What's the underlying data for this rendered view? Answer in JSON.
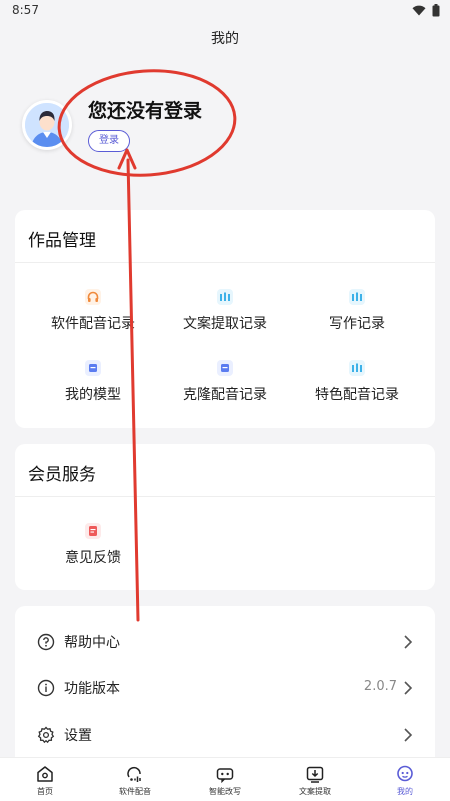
{
  "status_bar": {
    "time": "8:57"
  },
  "header": {
    "title": "我的"
  },
  "profile": {
    "title": "您还没有登录",
    "login_label": "登录"
  },
  "works": {
    "title": "作品管理",
    "items": [
      {
        "label": "软件配音记录",
        "icon": "headphones-icon"
      },
      {
        "label": "文案提取记录",
        "icon": "bars-icon"
      },
      {
        "label": "写作记录",
        "icon": "bars-icon"
      },
      {
        "label": "我的模型",
        "icon": "box-icon"
      },
      {
        "label": "克隆配音记录",
        "icon": "box-icon"
      },
      {
        "label": "特色配音记录",
        "icon": "bars-icon"
      }
    ]
  },
  "member": {
    "title": "会员服务",
    "items": [
      {
        "label": "意见反馈",
        "icon": "feedback-icon"
      }
    ]
  },
  "settings_list": [
    {
      "label": "帮助中心",
      "value": "",
      "icon": "help-icon"
    },
    {
      "label": "功能版本",
      "value": "2.0.7",
      "icon": "info-icon"
    },
    {
      "label": "设置",
      "value": "",
      "icon": "gear-icon"
    }
  ],
  "bottom_nav": [
    {
      "label": "首页",
      "icon": "home-icon",
      "active": false
    },
    {
      "label": "软件配音",
      "icon": "voice-icon",
      "active": false
    },
    {
      "label": "智能改写",
      "icon": "robot-icon",
      "active": false
    },
    {
      "label": "文案提取",
      "icon": "download-icon",
      "active": false
    },
    {
      "label": "我的",
      "icon": "profile-icon",
      "active": true
    }
  ],
  "colors": {
    "accent": "#5a5cd6",
    "annotation": "#e03a2f",
    "headphones": "#f08a3c",
    "bars": "#3db1e8",
    "box": "#5b7cf0",
    "feedback": "#ee5a5a"
  }
}
